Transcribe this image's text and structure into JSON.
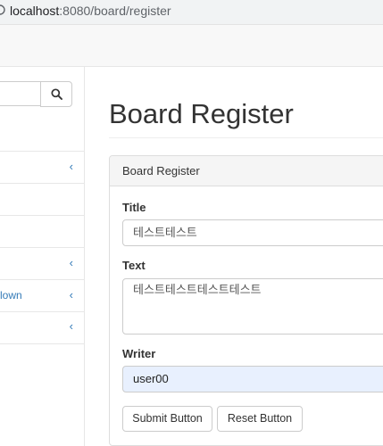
{
  "browser": {
    "url_host": "localhost",
    "url_rest": ":8080/board/register"
  },
  "sidebar": {
    "search": {
      "placeholder": ""
    },
    "items": [
      {
        "label": "",
        "chevron": ""
      },
      {
        "label": "",
        "chevron": "‹"
      },
      {
        "label": "",
        "chevron": ""
      },
      {
        "label": "",
        "chevron": ""
      },
      {
        "label": "",
        "chevron": "‹"
      },
      {
        "label": "lown",
        "chevron": "‹"
      },
      {
        "label": "",
        "chevron": "‹"
      }
    ]
  },
  "main": {
    "title": "Board Register",
    "panel_heading": "Board Register",
    "form": {
      "title_label": "Title",
      "title_value": "테스트테스트",
      "text_label": "Text",
      "text_value": "테스트테스트테스트테스트",
      "writer_label": "Writer",
      "writer_value": "user00"
    },
    "buttons": {
      "submit": "Submit Button",
      "reset": "Reset Button"
    }
  },
  "colors": {
    "link": "#337ab7",
    "autofill_bg": "#e8f0fe"
  }
}
